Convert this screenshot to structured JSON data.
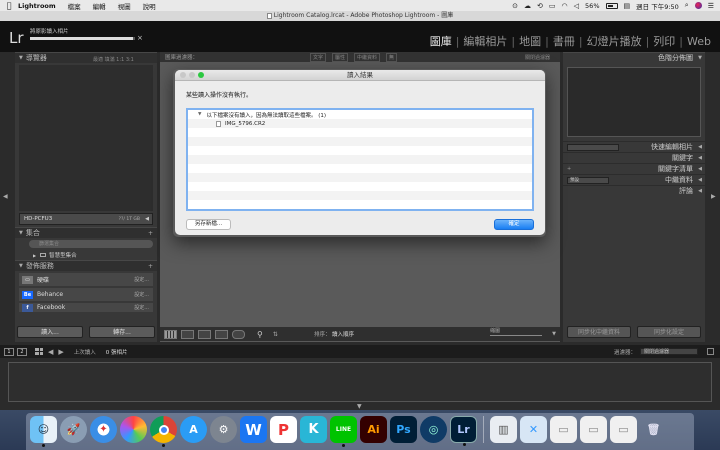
{
  "menubar": {
    "app_name": "Lightroom",
    "items": [
      "檔案",
      "編輯",
      "視圖",
      "說明"
    ],
    "battery": "56%",
    "clock": "週日 下午9:50"
  },
  "window": {
    "title": "Lightroom Catalog.lrcat - Adobe Photoshop Lightroom - 圖庫"
  },
  "identity": {
    "logo": "Lr",
    "import_status": "將原影讀入相片",
    "progress_fraction": 0.98,
    "cancel": "×"
  },
  "modules": [
    "圖庫",
    "編輯相片",
    "地圖",
    "書冊",
    "幻燈片播放",
    "列印",
    "Web"
  ],
  "left_panel": {
    "navigator_header": "導覽器",
    "navigator_modes": "最適  填滿  1:1  3:1",
    "drive_name": "HD-PCFU3",
    "drive_size": "??/ 1T GB",
    "collections_header": "集合",
    "collections_search": "篩選集合",
    "smart_collection": "智慧型集合",
    "publish_header": "發佈服務",
    "services": [
      {
        "name": "硬碟",
        "action": "設定..."
      },
      {
        "name": "Behance",
        "action": "設定..."
      },
      {
        "name": "Facebook",
        "action": "設定..."
      }
    ],
    "import_button": "讀入...",
    "export_button": "轉存..."
  },
  "center": {
    "filter_label": "圖庫過濾器：",
    "filter_options": [
      "文字",
      "屬性",
      "中繼資料",
      "無"
    ],
    "filter_preset": "關閉過濾器"
  },
  "toolbar": {
    "sort_label": "排序：",
    "sort_value": "讀入順序",
    "thumb_label": "縮圖"
  },
  "right_panel": {
    "histogram": "色階分佈圖",
    "quick_develop": "快速編輯相片",
    "keywording": "關鍵字",
    "keyword_list": "關鍵字清單",
    "metadata": "中繼資料",
    "metadata_preset": "預設",
    "comments": "評論",
    "sync_metadata": "同步化中繼資料",
    "sync_settings": "同步化設定"
  },
  "filmstrip": {
    "view1": "1",
    "view2": "2",
    "source": "上次讀入",
    "count": "0 張相片",
    "filter_label": "過濾器：",
    "filter_value": "關閉過濾器"
  },
  "dialog": {
    "title": "讀入結果",
    "message": "某些讀入操作沒有執行。",
    "group": "以下檔案沒有讀入，因為無法讀取這些檔案。 (1)",
    "file": "IMG_5796.CR2",
    "save_button": "另存新檔...",
    "ok_button": "確定"
  },
  "dock_apps": [
    "Finder",
    "Launchpad",
    "Safari",
    "Photos",
    "Chrome",
    "App Store",
    "System Preferences",
    "WPS",
    "Polaris",
    "Kakao",
    "LINE",
    "Illustrator",
    "Photoshop",
    "Lightroom Web",
    "Lightroom",
    "Preview",
    "Screenshot",
    "Chrome window 1",
    "Chrome window 2",
    "Chrome window 3",
    "Trash"
  ]
}
